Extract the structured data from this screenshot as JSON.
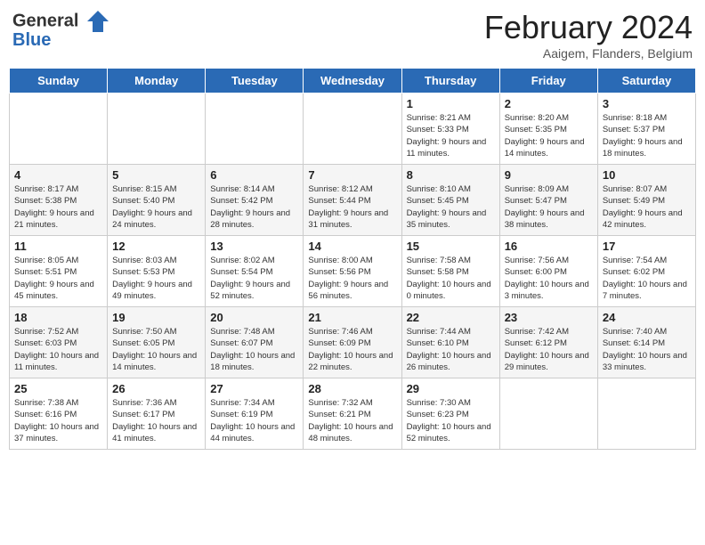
{
  "header": {
    "logo_line1": "General",
    "logo_line2": "Blue",
    "month_title": "February 2024",
    "subtitle": "Aaigem, Flanders, Belgium"
  },
  "weekdays": [
    "Sunday",
    "Monday",
    "Tuesday",
    "Wednesday",
    "Thursday",
    "Friday",
    "Saturday"
  ],
  "weeks": [
    [
      {
        "day": "",
        "info": ""
      },
      {
        "day": "",
        "info": ""
      },
      {
        "day": "",
        "info": ""
      },
      {
        "day": "",
        "info": ""
      },
      {
        "day": "1",
        "info": "Sunrise: 8:21 AM\nSunset: 5:33 PM\nDaylight: 9 hours\nand 11 minutes."
      },
      {
        "day": "2",
        "info": "Sunrise: 8:20 AM\nSunset: 5:35 PM\nDaylight: 9 hours\nand 14 minutes."
      },
      {
        "day": "3",
        "info": "Sunrise: 8:18 AM\nSunset: 5:37 PM\nDaylight: 9 hours\nand 18 minutes."
      }
    ],
    [
      {
        "day": "4",
        "info": "Sunrise: 8:17 AM\nSunset: 5:38 PM\nDaylight: 9 hours\nand 21 minutes."
      },
      {
        "day": "5",
        "info": "Sunrise: 8:15 AM\nSunset: 5:40 PM\nDaylight: 9 hours\nand 24 minutes."
      },
      {
        "day": "6",
        "info": "Sunrise: 8:14 AM\nSunset: 5:42 PM\nDaylight: 9 hours\nand 28 minutes."
      },
      {
        "day": "7",
        "info": "Sunrise: 8:12 AM\nSunset: 5:44 PM\nDaylight: 9 hours\nand 31 minutes."
      },
      {
        "day": "8",
        "info": "Sunrise: 8:10 AM\nSunset: 5:45 PM\nDaylight: 9 hours\nand 35 minutes."
      },
      {
        "day": "9",
        "info": "Sunrise: 8:09 AM\nSunset: 5:47 PM\nDaylight: 9 hours\nand 38 minutes."
      },
      {
        "day": "10",
        "info": "Sunrise: 8:07 AM\nSunset: 5:49 PM\nDaylight: 9 hours\nand 42 minutes."
      }
    ],
    [
      {
        "day": "11",
        "info": "Sunrise: 8:05 AM\nSunset: 5:51 PM\nDaylight: 9 hours\nand 45 minutes."
      },
      {
        "day": "12",
        "info": "Sunrise: 8:03 AM\nSunset: 5:53 PM\nDaylight: 9 hours\nand 49 minutes."
      },
      {
        "day": "13",
        "info": "Sunrise: 8:02 AM\nSunset: 5:54 PM\nDaylight: 9 hours\nand 52 minutes."
      },
      {
        "day": "14",
        "info": "Sunrise: 8:00 AM\nSunset: 5:56 PM\nDaylight: 9 hours\nand 56 minutes."
      },
      {
        "day": "15",
        "info": "Sunrise: 7:58 AM\nSunset: 5:58 PM\nDaylight: 10 hours\nand 0 minutes."
      },
      {
        "day": "16",
        "info": "Sunrise: 7:56 AM\nSunset: 6:00 PM\nDaylight: 10 hours\nand 3 minutes."
      },
      {
        "day": "17",
        "info": "Sunrise: 7:54 AM\nSunset: 6:02 PM\nDaylight: 10 hours\nand 7 minutes."
      }
    ],
    [
      {
        "day": "18",
        "info": "Sunrise: 7:52 AM\nSunset: 6:03 PM\nDaylight: 10 hours\nand 11 minutes."
      },
      {
        "day": "19",
        "info": "Sunrise: 7:50 AM\nSunset: 6:05 PM\nDaylight: 10 hours\nand 14 minutes."
      },
      {
        "day": "20",
        "info": "Sunrise: 7:48 AM\nSunset: 6:07 PM\nDaylight: 10 hours\nand 18 minutes."
      },
      {
        "day": "21",
        "info": "Sunrise: 7:46 AM\nSunset: 6:09 PM\nDaylight: 10 hours\nand 22 minutes."
      },
      {
        "day": "22",
        "info": "Sunrise: 7:44 AM\nSunset: 6:10 PM\nDaylight: 10 hours\nand 26 minutes."
      },
      {
        "day": "23",
        "info": "Sunrise: 7:42 AM\nSunset: 6:12 PM\nDaylight: 10 hours\nand 29 minutes."
      },
      {
        "day": "24",
        "info": "Sunrise: 7:40 AM\nSunset: 6:14 PM\nDaylight: 10 hours\nand 33 minutes."
      }
    ],
    [
      {
        "day": "25",
        "info": "Sunrise: 7:38 AM\nSunset: 6:16 PM\nDaylight: 10 hours\nand 37 minutes."
      },
      {
        "day": "26",
        "info": "Sunrise: 7:36 AM\nSunset: 6:17 PM\nDaylight: 10 hours\nand 41 minutes."
      },
      {
        "day": "27",
        "info": "Sunrise: 7:34 AM\nSunset: 6:19 PM\nDaylight: 10 hours\nand 44 minutes."
      },
      {
        "day": "28",
        "info": "Sunrise: 7:32 AM\nSunset: 6:21 PM\nDaylight: 10 hours\nand 48 minutes."
      },
      {
        "day": "29",
        "info": "Sunrise: 7:30 AM\nSunset: 6:23 PM\nDaylight: 10 hours\nand 52 minutes."
      },
      {
        "day": "",
        "info": ""
      },
      {
        "day": "",
        "info": ""
      }
    ]
  ]
}
